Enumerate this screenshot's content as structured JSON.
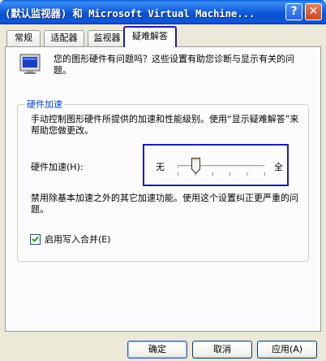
{
  "window": {
    "title": "(默认监视器) 和 Microsoft Virtual Machine...",
    "help_label": "?",
    "close_label": "✕",
    "title_color": "#0a5fd8"
  },
  "tabs": [
    {
      "label": "常规",
      "active": false
    },
    {
      "label": "适配器",
      "active": false
    },
    {
      "label": "监视器",
      "active": false
    },
    {
      "label": "疑难解答",
      "active": true
    }
  ],
  "intro": {
    "icon": "monitor-icon",
    "text": "您的图形硬件有问题吗？这些设置有助您诊断与显示有关的问题。"
  },
  "hardware_acceleration": {
    "group_title": "硬件加速",
    "description": "手动控制图形硬件所提供的加速和性能级别。使用“显示疑难解答”来帮助您做更改。",
    "slider_label": "硬件加速(H):",
    "slider_min_label": "无",
    "slider_max_label": "全",
    "slider_position_fraction": 0.2,
    "slider_steps": 6,
    "status_text": "禁用除基本加速之外的其它加速功能。使用这个设置纠正更严重的问题。"
  },
  "write_combining": {
    "label": "启用写入合并(E)",
    "checked": true
  },
  "buttons": {
    "ok": "确定",
    "cancel": "取消",
    "apply": "应用(A)"
  },
  "colors": {
    "highlight_border": "#1d1f9a",
    "group_title": "#0046d5",
    "dialog_background": "#ece9d8"
  }
}
